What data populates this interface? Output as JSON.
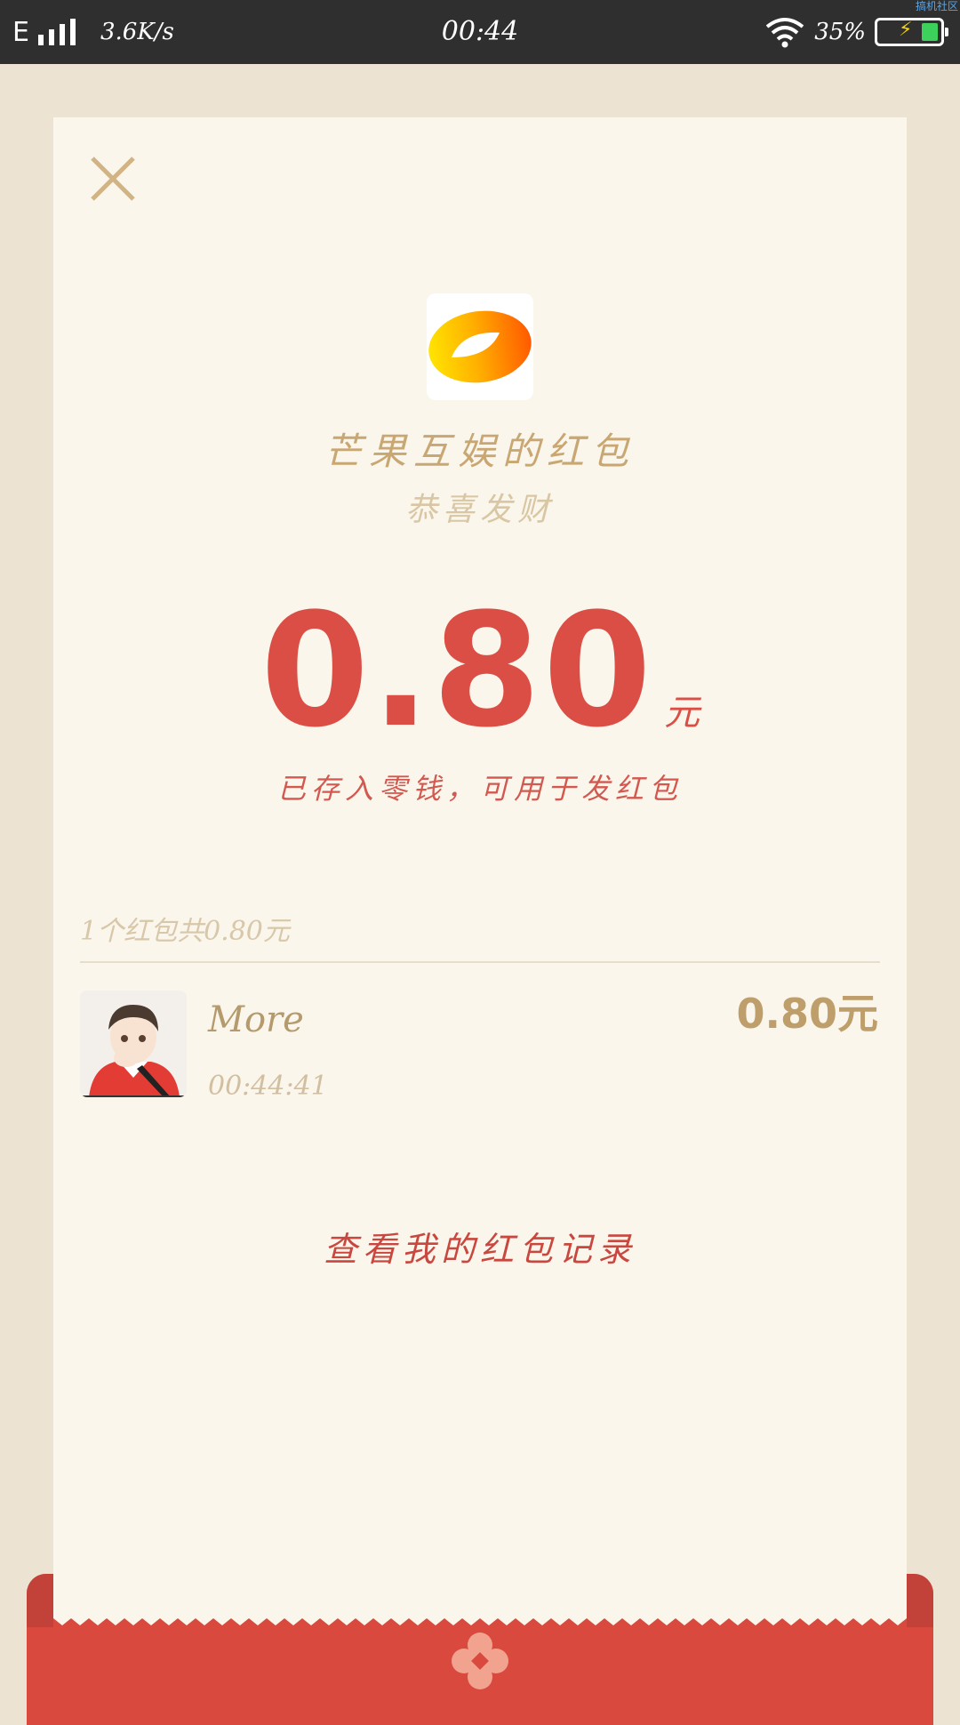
{
  "status_bar": {
    "network_type": "E",
    "signal_icon": "signal-bars-icon",
    "net_speed": "3.6K/s",
    "time": "00:44",
    "wifi_icon": "wifi-icon",
    "battery_percent": "35%",
    "battery_icon": "battery-charging-icon",
    "corner_text": "搞机社区"
  },
  "dialog": {
    "close_icon": "close-icon",
    "logo_icon": "mango-tv-logo-icon",
    "sender_title": "芒果互娱的红包",
    "greeting": "恭喜发财",
    "amount": "0.80",
    "currency": "元",
    "deposit_note": "已存入零钱，可用于发红包"
  },
  "summary": {
    "text": "1个红包共0.80元"
  },
  "records": [
    {
      "name": "More",
      "time": "00:44:41",
      "amount": "0.80元",
      "avatar_icon": "user-avatar"
    }
  ],
  "history_link": "查看我的红包记录",
  "envelope_emblem": "red-envelope-emblem-icon",
  "colors": {
    "accent_red": "#DB4E45",
    "gold": "#C8A772",
    "card_bg": "#FAF6EC",
    "page_bg": "#EDE3D2",
    "envelope_red": "#D9493E"
  }
}
